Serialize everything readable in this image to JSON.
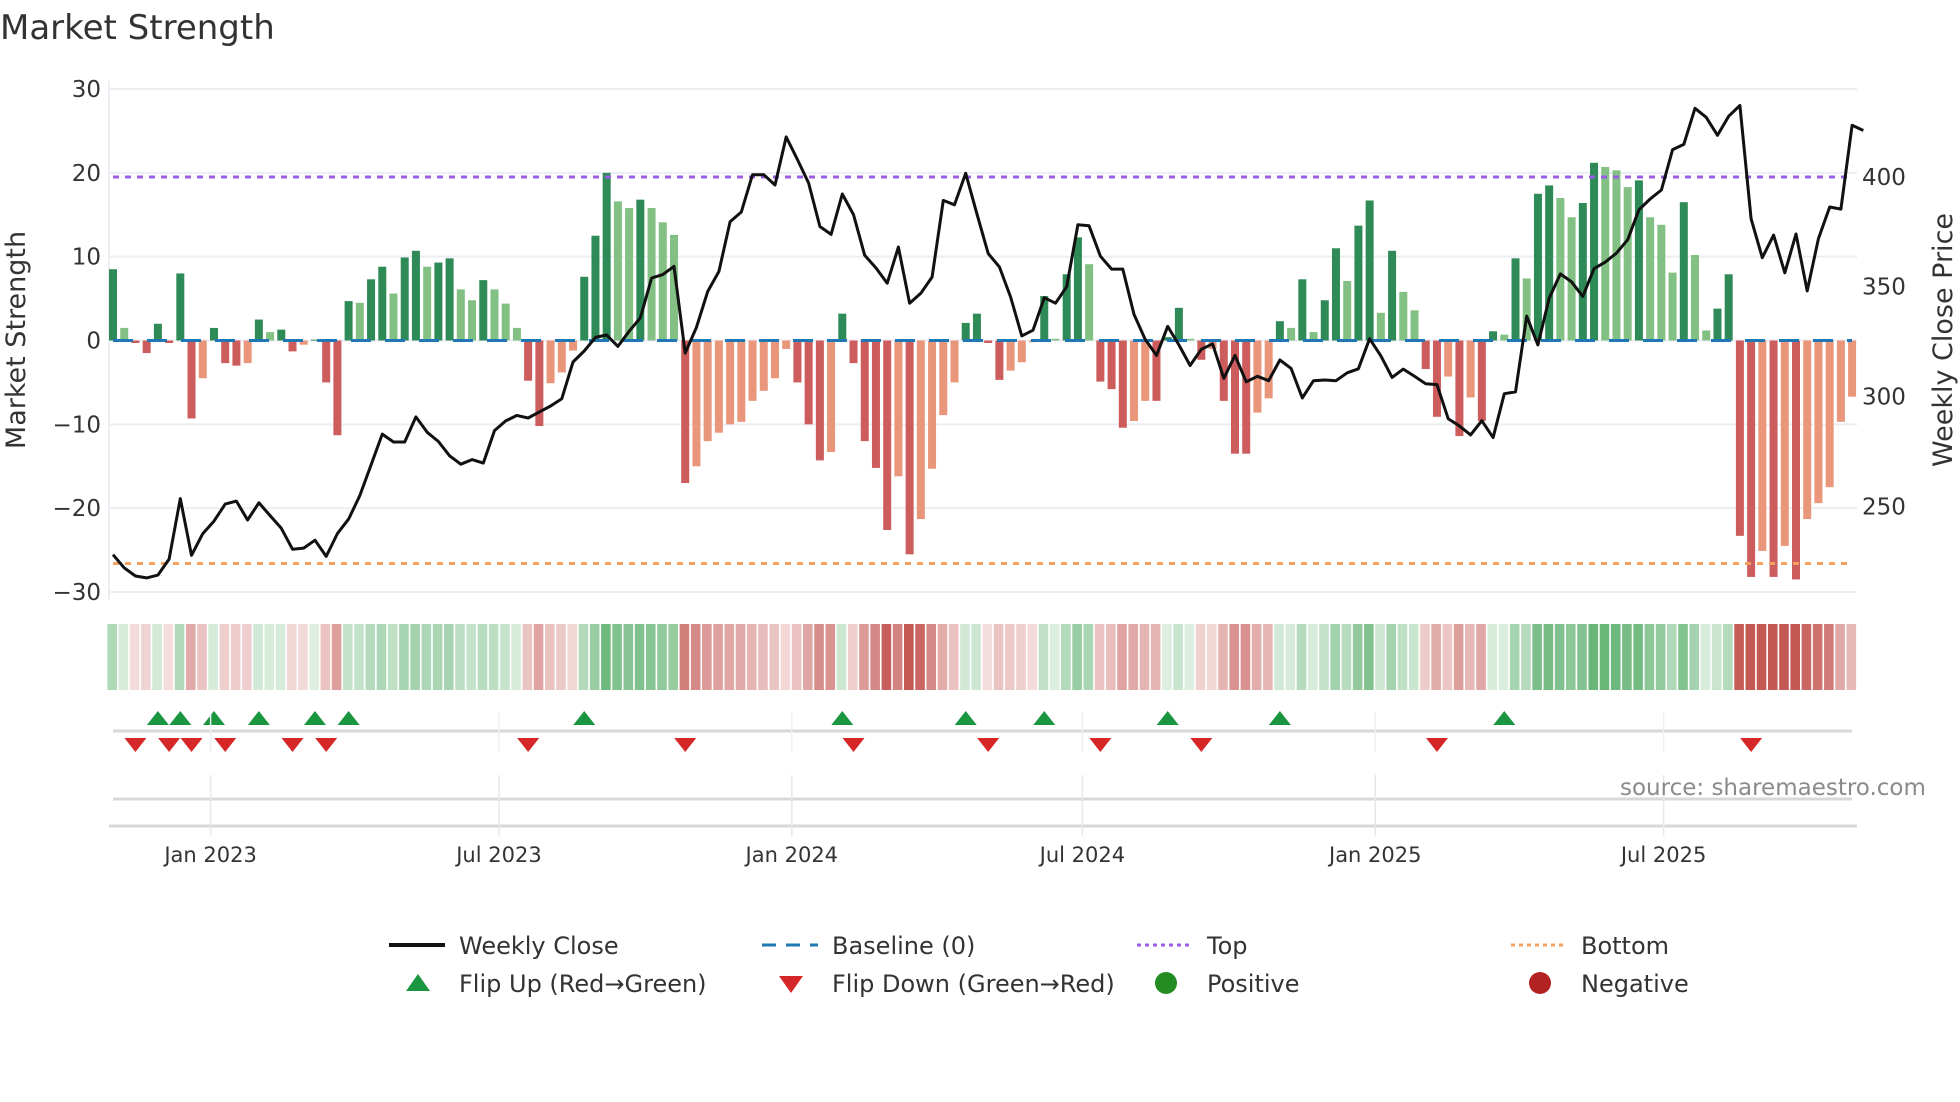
{
  "chart_data": {
    "type": "bar",
    "title": "Market Strength",
    "ylabel": "Market Strength",
    "y2label": "Weekly Close Price",
    "ylim": [
      -30,
      30
    ],
    "y2lim": [
      211,
      440
    ],
    "yticks": [
      -30,
      -20,
      -10,
      0,
      10,
      20,
      30
    ],
    "yticks_labels": [
      "−30",
      "−20",
      "−10",
      "0",
      "10",
      "20",
      "30"
    ],
    "y2ticks": [
      250,
      300,
      350,
      400
    ],
    "y2ticks_labels": [
      "250",
      "300",
      "350",
      "400"
    ],
    "x_ticks": [
      {
        "label": "Jan 2023",
        "week": 8.7
      },
      {
        "label": "Jul 2023",
        "week": 34.4
      },
      {
        "label": "Jan 2024",
        "week": 60.5
      },
      {
        "label": "Jul 2024",
        "week": 86.4
      },
      {
        "label": "Jan 2025",
        "week": 112.5
      },
      {
        "label": "Jul 2025",
        "week": 138.2
      }
    ],
    "top_line": 19.5,
    "bottom_line": -26.6,
    "baseline": 0,
    "strength": [
      8.5,
      1.5,
      -0.3,
      -1.5,
      2,
      -0.3,
      8,
      -9.3,
      -4.5,
      1.5,
      -2.7,
      -3,
      -2.7,
      2.5,
      1,
      1.3,
      -1.3,
      -0.5,
      0.1,
      -5,
      -11.3,
      4.7,
      4.5,
      7.3,
      8.8,
      5.6,
      9.9,
      10.7,
      8.8,
      9.3,
      9.8,
      6.1,
      4.8,
      7.2,
      6.1,
      4.4,
      1.5,
      -4.8,
      -10.2,
      -5.1,
      -3.8,
      -1.2,
      7.6,
      12.5,
      20,
      16.6,
      15.8,
      16.8,
      15.8,
      14.1,
      12.6,
      -17,
      -15,
      -12,
      -11,
      -10,
      -9.7,
      -7.2,
      -6,
      -4.5,
      -1,
      -5,
      -10,
      -14.3,
      -13.3,
      3.2,
      -2.7,
      -12,
      -15.2,
      -22.6,
      -16.2,
      -25.5,
      -21.3,
      -15.3,
      -8.9,
      -5,
      2.1,
      3.2,
      -0.3,
      -4.7,
      -3.6,
      -2.6,
      -0.2,
      5.3,
      0.2,
      7.9,
      12.3,
      9.1,
      -4.9,
      -5.8,
      -10.4,
      -9.6,
      -7.2,
      -7.2,
      0.4,
      3.9,
      0.2,
      -2.3,
      -1,
      -7.2,
      -13.5,
      -13.5,
      -8.6,
      -6.9,
      2.3,
      1.5,
      7.3,
      1,
      4.8,
      11,
      7.1,
      13.7,
      16.7,
      3.3,
      10.7,
      5.8,
      3.6,
      -3.4,
      -9.1,
      -4.3,
      -11.4,
      -6.8,
      -9.6,
      1.1,
      0.7,
      9.8,
      7.4,
      17.5,
      18.5,
      17,
      14.7,
      16.4,
      21.2,
      20.7,
      20.3,
      18.3,
      19.1,
      14.7,
      13.8,
      8.1,
      16.5,
      10.2,
      1.2,
      3.8,
      7.9,
      -23.3,
      -28.2,
      -25.1,
      -28.2,
      -24.5,
      -28.5,
      -21.3,
      -19.4,
      -17.5,
      -9.7,
      -6.7
    ],
    "weekly_close": [
      228,
      222,
      218.3,
      217.4,
      218.7,
      226,
      253.5,
      227.7,
      237.6,
      243.3,
      251,
      252.4,
      243.8,
      251.6,
      245.8,
      240,
      230.5,
      231,
      234.6,
      227.2,
      237.6,
      244.2,
      254.9,
      268.9,
      282.9,
      279.3,
      279.3,
      290.7,
      283.7,
      279.5,
      273,
      269.2,
      271.3,
      269.7,
      284.5,
      288.9,
      291.4,
      290.2,
      293,
      295.7,
      299,
      315.7,
      320.7,
      326.9,
      328,
      322.8,
      329.7,
      335.8,
      353.9,
      355.5,
      359.3,
      319.8,
      331.4,
      347.8,
      356.9,
      379.6,
      384,
      401,
      401,
      396.3,
      418.2,
      407.9,
      397.2,
      377.4,
      373.8,
      392.2,
      382.8,
      364.3,
      358.5,
      351.6,
      368,
      342.5,
      347,
      354.4,
      389.3,
      387.3,
      401.6,
      383.2,
      365.1,
      359,
      345.3,
      327.6,
      330.2,
      345,
      342.5,
      350,
      378.2,
      377.7,
      363.9,
      358,
      358,
      337.4,
      326,
      318.7,
      331.9,
      323.5,
      314.1,
      321.5,
      324,
      308.3,
      318.7,
      306.7,
      309.2,
      307.2,
      316.6,
      312.8,
      299.3,
      307.2,
      307.5,
      307.2,
      310.8,
      312.6,
      326.3,
      318.5,
      308.7,
      312.5,
      309.2,
      305.8,
      305.4,
      289.9,
      286.6,
      282.5,
      289,
      281.3,
      301.3,
      302.1,
      336.6,
      323.5,
      344.8,
      355.8,
      352.2,
      345.6,
      358.2,
      361.2,
      365.3,
      371.4,
      385,
      389.9,
      394,
      412.4,
      414.8,
      431.2,
      427.1,
      418.9,
      427.6,
      432.5,
      380.9,
      363.2,
      373.5,
      356.3,
      374,
      348.1,
      371.8,
      386.3,
      385.3,
      423.5,
      421.1
    ],
    "flip_up_weeks": [
      4,
      6,
      9,
      13,
      18,
      21,
      42,
      65,
      76,
      83,
      94,
      104,
      124
    ],
    "flip_down_weeks": [
      2,
      5,
      7,
      10,
      16,
      19,
      37,
      51,
      66,
      78,
      88,
      97,
      118,
      146
    ],
    "legend_placement": "bottom-center",
    "legend": [
      {
        "label": "Weekly Close",
        "symbol": "line-solid",
        "color": "#111111"
      },
      {
        "label": "Baseline (0)",
        "symbol": "line-dashed",
        "color": "#1f77b4"
      },
      {
        "label": "Top",
        "symbol": "line-dotted",
        "color": "#9b5de5"
      },
      {
        "label": "Bottom",
        "symbol": "line-dotted",
        "color": "#f4a261"
      },
      {
        "label": "Flip Up (Red→Green)",
        "symbol": "triangle-up",
        "color": "#1a9641"
      },
      {
        "label": "Flip Down (Green→Red)",
        "symbol": "triangle-down",
        "color": "#d62728"
      },
      {
        "label": "Positive",
        "symbol": "circle",
        "color": "#228b22"
      },
      {
        "label": "Negative",
        "symbol": "circle",
        "color": "#b22222"
      }
    ],
    "source": "source: sharemaestro.com"
  },
  "colors": {
    "pos_strong": "#2e8b57",
    "pos_weak": "#82c083",
    "neg_strong": "#cd5c5c",
    "neg_weak": "#e9967a",
    "grid": "#eceef4"
  }
}
